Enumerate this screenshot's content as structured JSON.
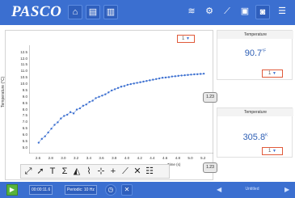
{
  "app": {
    "logo": "PASCO"
  },
  "toolbar_top": {
    "home_icon": "home-icon",
    "page_icon": "page-icon",
    "journal_icon": "journal-icon",
    "wifi_icon": "wifi-icon",
    "sensor_icon": "sensor-icon",
    "graph_tools_icon": "graph-tools-icon",
    "folder_icon": "folder-icon",
    "camera_icon": "camera-icon",
    "menu_icon": "menu-icon"
  },
  "graph": {
    "run_selector_label": "1",
    "y_axis_title": "Temperature (°C)",
    "y_ticks": [
      "12.5",
      "12.0",
      "11.5",
      "11.0",
      "10.5",
      "10.0",
      "9.5",
      "9.0",
      "8.5",
      "8.0",
      "7.5",
      "7.0",
      "6.5",
      "6.0",
      "5.5",
      "5.0"
    ],
    "x_ticks": [
      "2.6",
      "2.8",
      "3.0",
      "3.2",
      "3.4",
      "3.6",
      "3.8",
      "4.0",
      "4.2",
      "4.4",
      "4.6",
      "4.8",
      "5.0",
      "5.2"
    ],
    "x_axis_title": "Time (s)",
    "scale_pill_right": "1.23",
    "scale_pill_bottom": "1.23",
    "series_color": "#3b6fd0"
  },
  "chart_data": {
    "type": "scatter",
    "title": "",
    "xlabel": "Time (s)",
    "ylabel": "Temperature (°C)",
    "xlim": [
      2.5,
      5.3
    ],
    "ylim": [
      4.8,
      12.8
    ],
    "series": [
      {
        "x": [
          2.6,
          2.65,
          2.7,
          2.75,
          2.8,
          2.85,
          2.9,
          2.95,
          3.0,
          3.05,
          3.1,
          3.15,
          3.2,
          3.25,
          3.3,
          3.35,
          3.4,
          3.45,
          3.5,
          3.55,
          3.6,
          3.65,
          3.7,
          3.75,
          3.8,
          3.85,
          3.9,
          3.95,
          4.0,
          4.05,
          4.1,
          4.15,
          4.2,
          4.25,
          4.3,
          4.35,
          4.4,
          4.45,
          4.5,
          4.55,
          4.6,
          4.65,
          4.7,
          4.75,
          4.8,
          4.85,
          4.9,
          4.95,
          5.0,
          5.05,
          5.1,
          5.15,
          5.2
        ],
        "values": [
          5.4,
          5.7,
          5.9,
          6.2,
          6.5,
          6.8,
          7.0,
          7.3,
          7.5,
          7.6,
          7.8,
          7.7,
          8.0,
          8.1,
          8.3,
          8.4,
          8.6,
          8.7,
          8.9,
          9.0,
          9.1,
          9.2,
          9.35,
          9.5,
          9.6,
          9.7,
          9.8,
          9.85,
          9.95,
          10.0,
          10.05,
          10.1,
          10.15,
          10.2,
          10.25,
          10.3,
          10.35,
          10.4,
          10.45,
          10.5,
          10.52,
          10.55,
          10.6,
          10.62,
          10.65,
          10.68,
          10.7,
          10.72,
          10.75,
          10.77,
          10.78,
          10.8,
          10.82
        ]
      }
    ]
  },
  "graph_tools": {
    "scale_icon": "scale-to-fit-icon",
    "select_icon": "select-arrow-icon",
    "text_icon": "text-annotation-icon",
    "stats_icon": "statistics-icon",
    "area_icon": "area-icon",
    "fit_icon": "curve-fit-icon",
    "coord_icon": "coordinates-icon",
    "crosshair_icon": "crosshair-icon",
    "slope_icon": "slope-icon",
    "delete_icon": "delete-icon",
    "list_icon": "list-icon"
  },
  "digits": [
    {
      "header": "Temperature",
      "value": "90.7",
      "unit": "°F",
      "run_label": "1"
    },
    {
      "header": "Temperature",
      "value": "305.8",
      "unit": "K",
      "run_label": "1"
    }
  ],
  "bottom": {
    "timer": "00:00:11.6",
    "sample_rate": "Periodic: 10 Hz",
    "page_label": "Untitled"
  }
}
